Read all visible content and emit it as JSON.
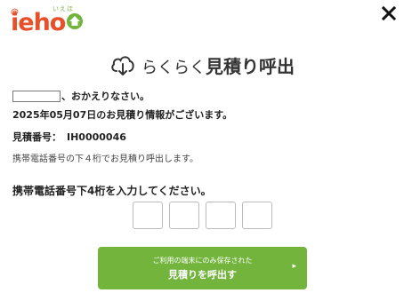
{
  "logo": {
    "text": "ieho",
    "kana": "いえほ",
    "at_mark": "@"
  },
  "title": {
    "prefix": "らくらく",
    "main": "見積り呼出"
  },
  "greeting": {
    "suffix": "、おかえりなさい。"
  },
  "date_line": "2025年05月07日のお見積り情報がございます。",
  "quote": {
    "label": "見積番号：",
    "number": "IH0000046"
  },
  "info": "携帯電話番号の下４桁でお見積り呼出します。",
  "prompt": "携帯電話番号下4桁を入力してください。",
  "digits": [
    "",
    "",
    "",
    ""
  ],
  "button": {
    "sub": "ご利用の端末にのみ保存された",
    "main": "見積りを呼出す",
    "arrow": "▸"
  },
  "colors": {
    "brand_orange": "#e8502a",
    "brand_green": "#72b43c"
  },
  "icons": [
    "cloud-download-icon",
    "close-icon",
    "house-icon"
  ]
}
